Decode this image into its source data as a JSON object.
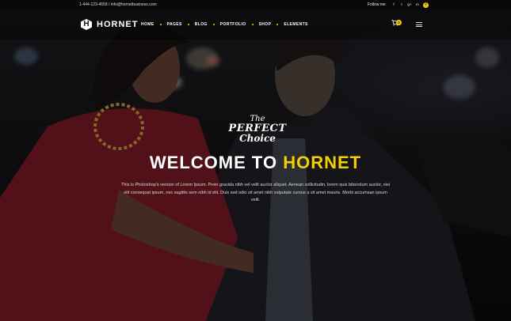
{
  "topbar": {
    "contact": "1-444-123-4559 / info@hornetbusiness.com",
    "follow_label": "Follow me",
    "social_icons": [
      "facebook-icon",
      "twitter-icon",
      "google-plus-icon",
      "linkedin-icon",
      "search-icon"
    ]
  },
  "brand": {
    "logo_letter": "H",
    "name": "HORNET"
  },
  "nav": {
    "items": [
      {
        "label": "HOME"
      },
      {
        "label": "PAGES"
      },
      {
        "label": "BLOG"
      },
      {
        "label": "PORTFOLIO"
      },
      {
        "label": "SHOP"
      },
      {
        "label": "ELEMENTS"
      }
    ],
    "cart_count": "0"
  },
  "hero": {
    "script_line1": "The",
    "script_line2": "PERFECT",
    "script_line3": "Choice",
    "title_prefix": "WELCOME TO ",
    "title_accent": "HORNET",
    "text": "This is Photoshop's version of Lorem Ipsum. Proin gravida nibh vel velit auctor aliquet. Aenean sollicitudin, lorem quis bibendum auctor, nisi elit consequat ipsum, nec sagittis sem nibh id elit. Duis sed odio sit amet nibh vulputate cursus a sit amet mauris. Morbi accumsan ipsum velit."
  },
  "colors": {
    "accent": "#f5d000",
    "background": "#0b0b0d"
  }
}
